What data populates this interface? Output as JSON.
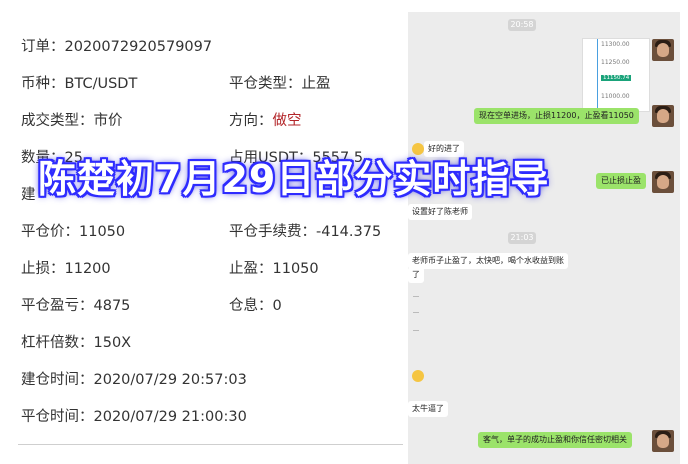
{
  "order": {
    "order_no_label": "订单：",
    "order_no": "2020072920579097",
    "currency_label": "币种：",
    "currency": "BTC/USDT",
    "close_type_label": "平仓类型：",
    "close_type": "止盈",
    "deal_type_label": "成交类型：",
    "deal_type": "市价",
    "direction_label": "方向：",
    "direction": "做空",
    "qty_label": "数量：",
    "qty": "25",
    "usdt_label": "占用USDT：",
    "usdt": "5557.5",
    "open_label_partial": "建",
    "close_price_label": "平仓价：",
    "close_price": "11050",
    "close_fee_label": "平仓手续费：",
    "close_fee": "-414.375",
    "stop_loss_label": "止损：",
    "stop_loss": "11200",
    "take_profit_label": "止盈：",
    "take_profit": "11050",
    "pnl_label": "平仓盈亏：",
    "pnl": "4875",
    "interest_label": "仓息：",
    "interest": "0",
    "leverage_label": "杠杆倍数：",
    "leverage": "150X",
    "open_time_label": "建仓时间：",
    "open_time": "2020/07/29 20:57:03",
    "close_time_label": "平仓时间：",
    "close_time": "2020/07/29 21:00:30"
  },
  "chat": {
    "time1": "20:58",
    "chart_ticks": [
      "11300.00",
      "11250.00",
      "11150.74",
      "11000.00"
    ],
    "msg1": "现在空单进场，止损11200，止盈看11050",
    "msg2": "好的进了",
    "msg3": "已止损止盈",
    "msg4": "设置好了陈老师",
    "time2": "21:03",
    "msg5": "老师币子止盈了，太快吧，喝个水收益到账",
    "msg5b": "了",
    "msg6": "太牛逼了",
    "msg7": "客气，单子的成功止盈和你信任密切相关"
  },
  "overlay_title": "陈楚初7月29日部分实时指导",
  "colors": {
    "direction_red": "#b3262a",
    "chat_green": "#9be36a",
    "overlay_blue": "#2f2cff"
  }
}
